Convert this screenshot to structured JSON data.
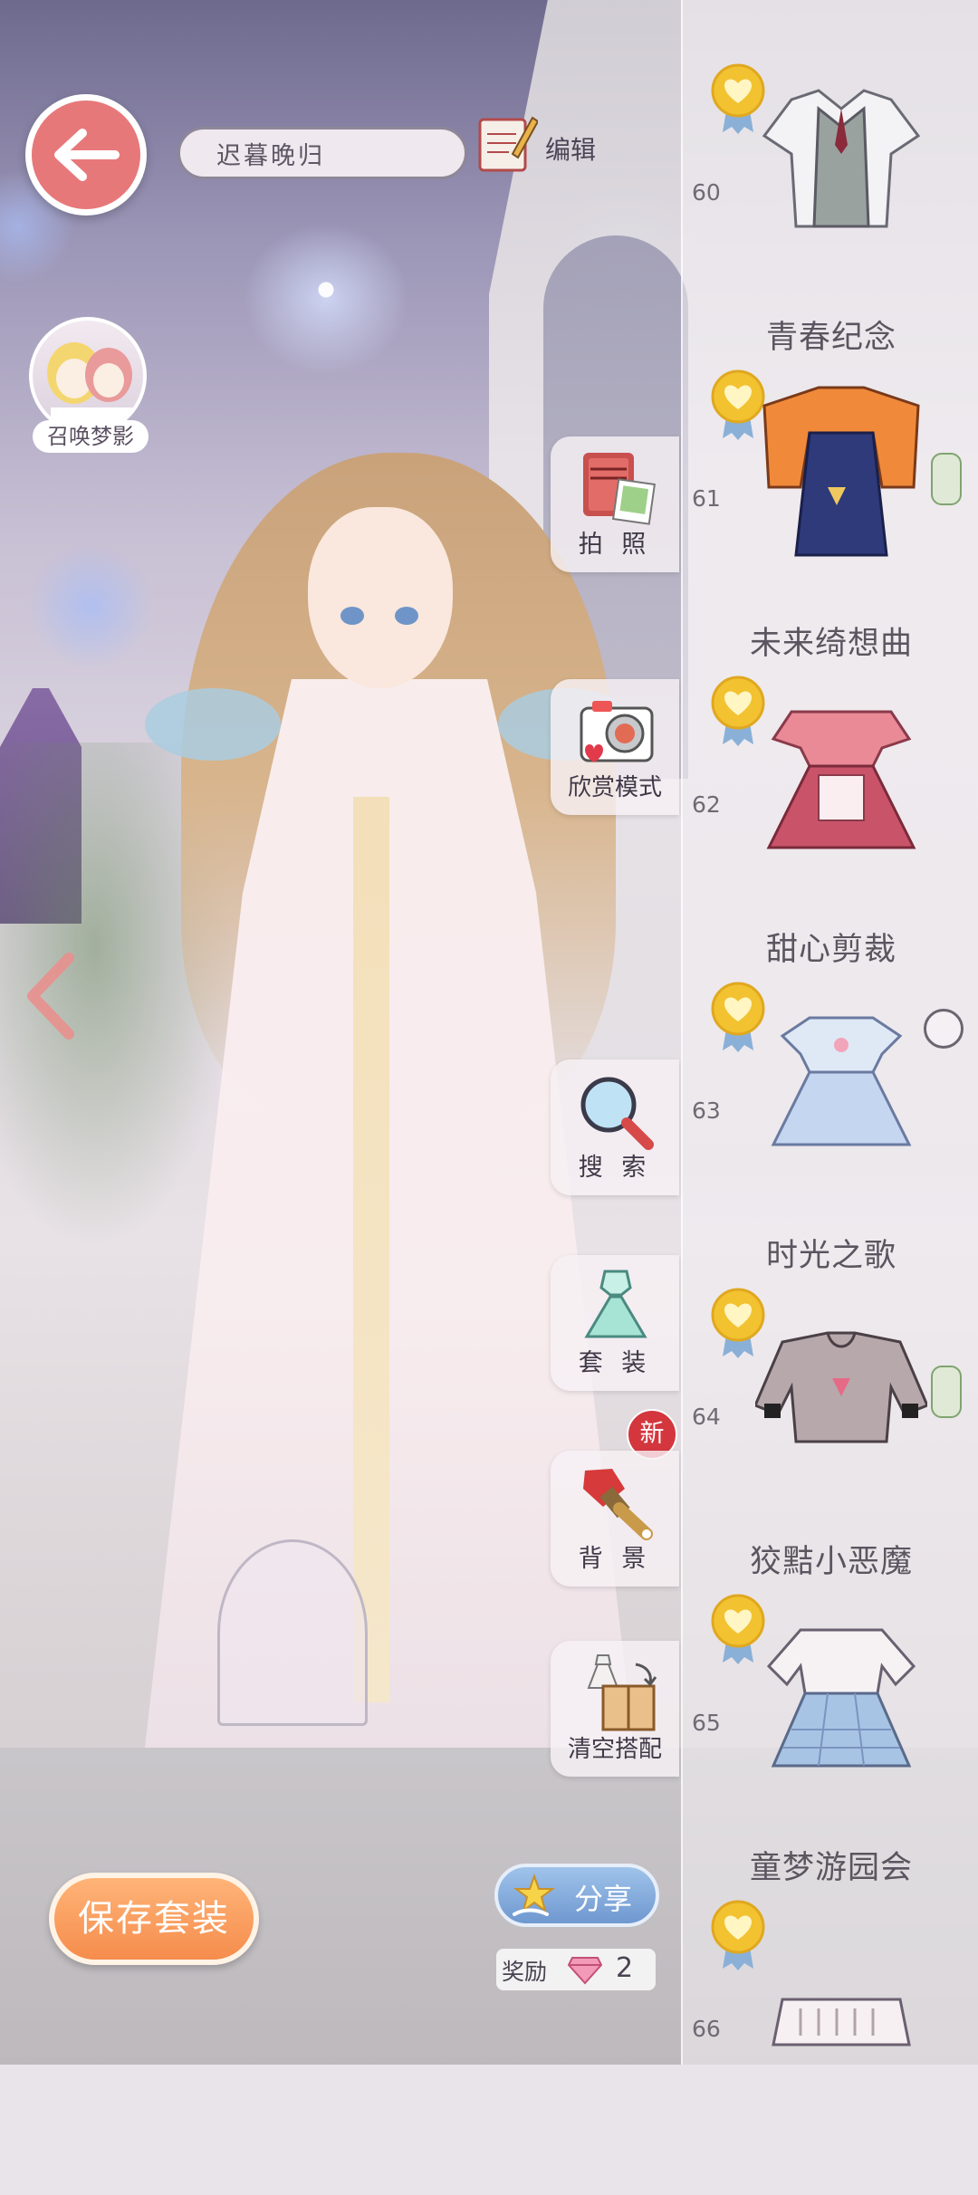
{
  "header": {
    "outfit_name": "迟暮晚归",
    "edit_label": "编辑"
  },
  "summon": {
    "label": "召唤梦影"
  },
  "tools": {
    "photo": "拍 照",
    "appreciate": "欣赏模式",
    "search": "搜 索",
    "suit": "套 装",
    "new_badge": "新",
    "background": "背 景",
    "clear": "清空搭配"
  },
  "bottom": {
    "save_label": "保存套装",
    "share_label": "分享",
    "reward_label": "奖励",
    "reward_count": "2"
  },
  "list": {
    "items": [
      {
        "num": "60",
        "name": "青春纪念"
      },
      {
        "num": "61",
        "name": "未来绮想曲"
      },
      {
        "num": "62",
        "name": "甜心剪裁"
      },
      {
        "num": "63",
        "name": "时光之歌"
      },
      {
        "num": "64",
        "name": "狡黠小恶魔"
      },
      {
        "num": "65",
        "name": "童梦游园会"
      },
      {
        "num": "66",
        "name": ""
      }
    ]
  },
  "colors": {
    "back_button": "#e7787a",
    "save_button": "#f58c4c",
    "share_button": "#6f98d0",
    "medal_gold": "#f2c230",
    "new_badge": "#d4363e"
  },
  "icons": [
    "back-arrow-icon",
    "notepad-pencil-icon",
    "photo-album-icon",
    "camera-icon",
    "magnifier-icon",
    "dress-icon",
    "paint-brush-icon",
    "box-dress-icon",
    "star-hand-icon",
    "gem-icon",
    "heart-medal-icon",
    "left-chevron-icon"
  ]
}
